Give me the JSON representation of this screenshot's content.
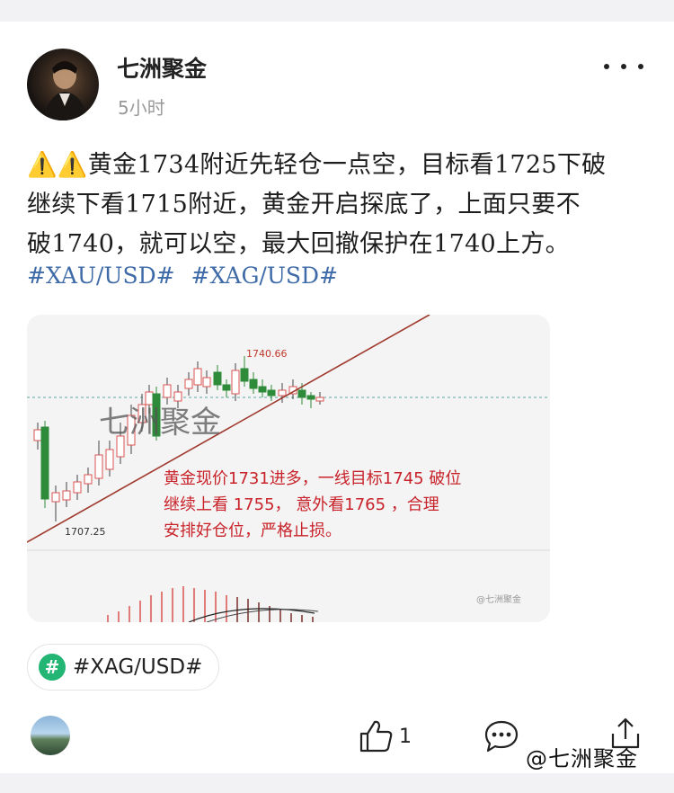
{
  "post": {
    "author": "七洲聚金",
    "time": "5小时",
    "warning_icons": "⚠️⚠️",
    "lines": [
      "黄金1734附近先轻仓一点空，目标看1725下破",
      "继续下看1715附近，黄金开启探底了，上面只要不",
      "破1740，就可以空，最大回撤保护在1740上方。"
    ],
    "hashtags": [
      "#XAU/USD#",
      "#XAG/USD#"
    ]
  },
  "chart": {
    "high_label": "1740.66",
    "low_label": "1707.25",
    "watermark": "七洲聚金",
    "annotation_lines": [
      "黄金现价1731进多，一线目标1745 破位",
      "继续上看 1755，  意外看1765  ，合理",
      "安排好仓位，严格止损。"
    ],
    "corner_mark": "@七洲聚金",
    "colors": {
      "up": "#d9534f",
      "down": "#2e8b3a",
      "trendline": "#a03a2e",
      "annotation": "#c8232a"
    }
  },
  "topic": {
    "icon": "#",
    "label": "#XAG/USD#"
  },
  "actions": {
    "like_count": "1"
  },
  "footer_watermark": "@七洲聚金",
  "icons": {
    "more": "more-icon",
    "like": "thumbs-up-icon",
    "comment": "comment-icon",
    "share": "share-icon",
    "topic": "hashtag-icon"
  }
}
